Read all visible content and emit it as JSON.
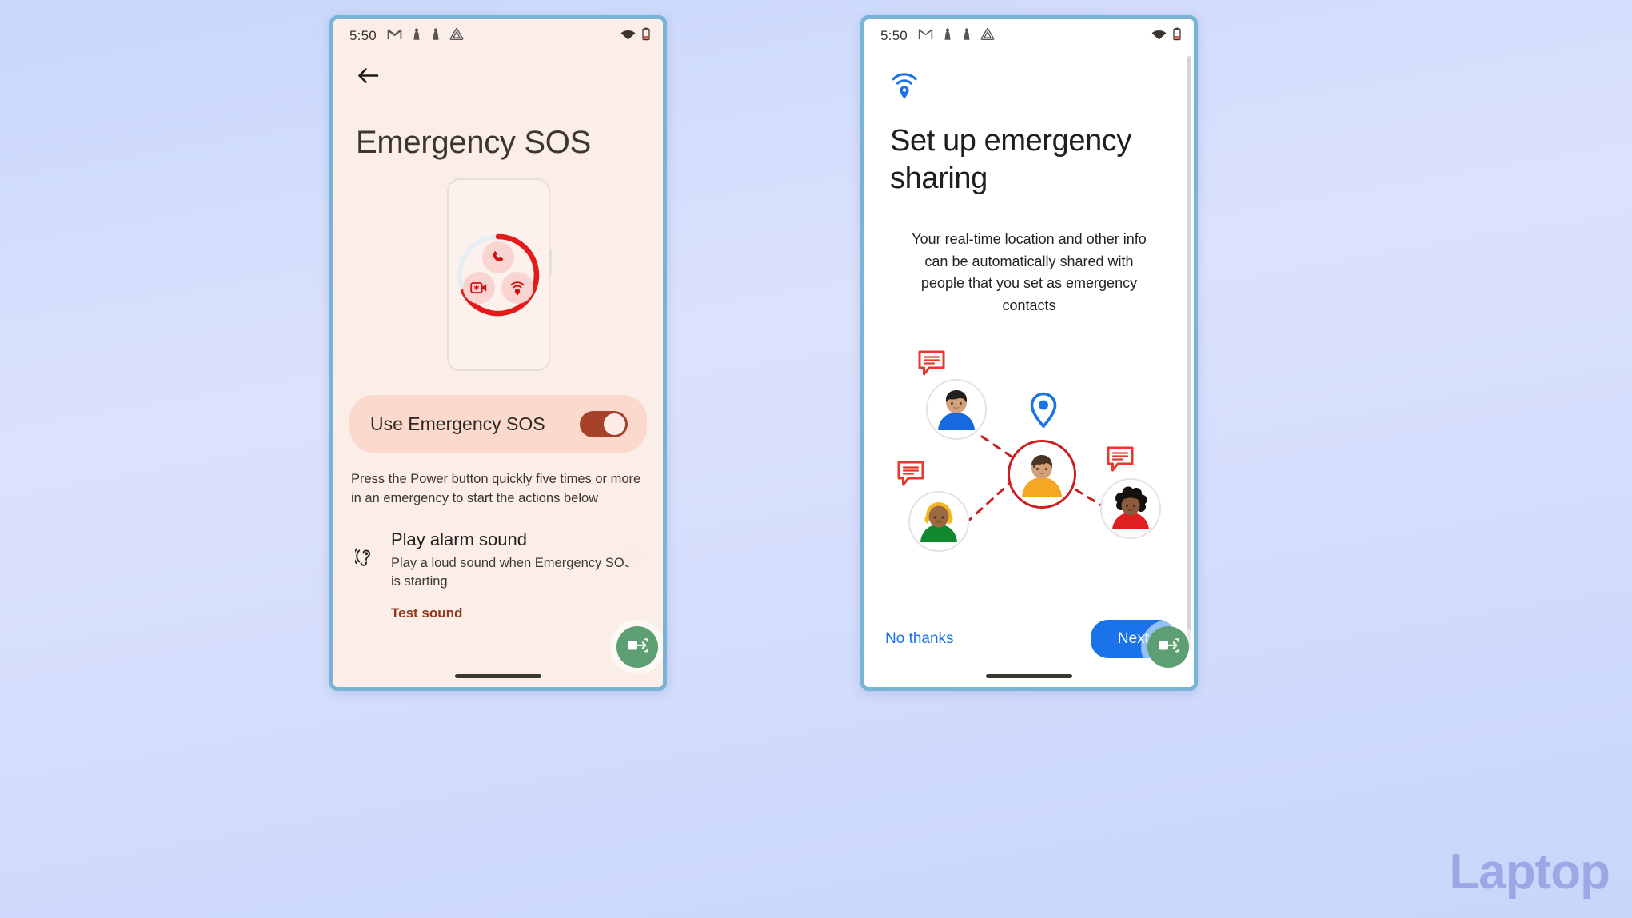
{
  "page": {
    "watermark": "Laptop",
    "background_color": "#d3dcfc",
    "frame_border_color": "#79b3d6"
  },
  "phone_left": {
    "background_color": "#fbeee9",
    "statusbar": {
      "time": "5:50",
      "left_icons": [
        "gmail-icon",
        "notification-pawn-icon",
        "notification-pawn-icon",
        "drive-triangle-icon"
      ],
      "right_icons": [
        "wifi-icon",
        "battery-low-icon"
      ]
    },
    "back_label": "Back",
    "title": "Emergency SOS",
    "illustration": {
      "name": "emergency-sos-countdown-illustration",
      "ring_progress_percent": 75,
      "ring_color": "#e31b1b",
      "ring_track_color": "#e3ecf0",
      "action_icons": [
        "emergency-call-icon",
        "emergency-video-icon",
        "emergency-location-beacon-icon"
      ]
    },
    "main_toggle": {
      "label": "Use Emergency SOS",
      "state": "on",
      "accent_color": "#a7422a",
      "pill_color": "#fbd9cd"
    },
    "helper_text": "Press the Power button quickly five times or more in an emergency to start the actions below",
    "alarm_setting": {
      "icon": "hearing-sound-icon",
      "title": "Play alarm sound",
      "description": "Play a loud sound when Emergency SOS is starting",
      "link_label": "Test sound",
      "link_color": "#92391f",
      "state": "on"
    },
    "accessibility_fab": {
      "icon": "screen-transfer-icon",
      "color": "#5d9e72"
    }
  },
  "phone_right": {
    "background_color": "#ffffff",
    "statusbar": {
      "time": "5:50",
      "left_icons": [
        "gmail-icon",
        "notification-pawn-icon",
        "notification-pawn-icon",
        "drive-triangle-icon"
      ],
      "right_icons": [
        "wifi-icon",
        "battery-low-icon"
      ]
    },
    "header_icon": "location-broadcast-icon",
    "header_icon_color": "#1a73e8",
    "title": "Set up emergency sharing",
    "body": "Your real-time location and other info can be automatically shared with people that you set as emergency contacts",
    "illustration": {
      "name": "emergency-contacts-network-illustration",
      "center_person": {
        "shirt_color": "#f5a623",
        "ring_color": "#cc1f1f",
        "hair_color": "#4a3525"
      },
      "location_pin_color": "#1a73e8",
      "link_color": "#cc1f1f",
      "link_style": "dashed",
      "contacts": [
        {
          "position": "top-left",
          "shirt_color": "#1769e0",
          "hair_color": "#20201f",
          "has_message_bubble": true
        },
        {
          "position": "bottom-left",
          "shirt_color": "#12892f",
          "hair_color": "#f5b721",
          "has_message_bubble": true
        },
        {
          "position": "bottom-right",
          "shirt_color": "#e02020",
          "hair_color": "#15100d",
          "has_message_bubble": true
        }
      ],
      "message_bubble_color": "#e8372b"
    },
    "footer": {
      "secondary_label": "No thanks",
      "primary_label": "Next",
      "primary_color": "#1a73e8",
      "secondary_color": "#1a73e8"
    },
    "accessibility_fab": {
      "icon": "screen-transfer-icon",
      "color": "#5d9e72"
    },
    "scrollbar": {
      "visible": true
    }
  }
}
